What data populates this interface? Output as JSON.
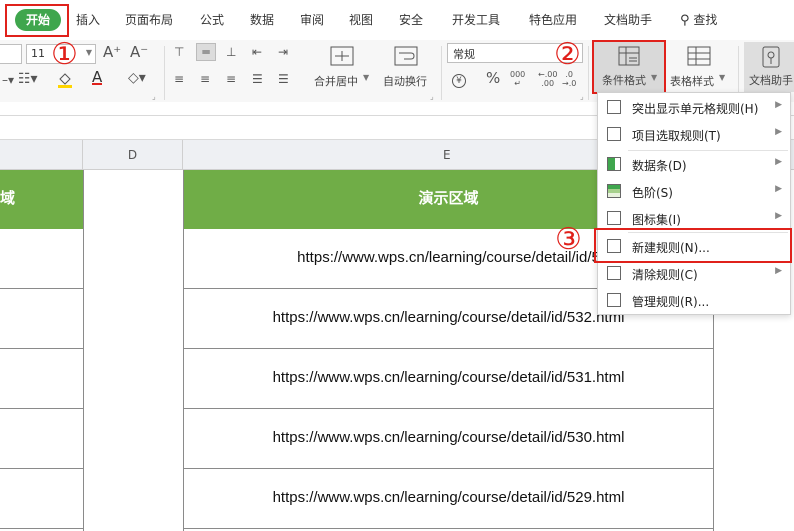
{
  "tabs": {
    "home": "开始",
    "items": [
      "插入",
      "页面布局",
      "公式",
      "数据",
      "审阅",
      "视图",
      "安全",
      "开发工具",
      "特色应用",
      "文档助手"
    ],
    "search": "查找"
  },
  "ribbon": {
    "font_size": "11",
    "font_grow": "A⁺",
    "font_shrink": "A⁻",
    "merge_label": "合并居中",
    "wrap_label": "自动换行",
    "number_format": "常规",
    "currency": "¥",
    "percent": "%",
    "thousands": "000",
    "dec_inc": ".00",
    "dec_dec": ".0",
    "cond_format_label": "条件格式",
    "table_style_label": "表格样式",
    "doc_helper_label": "文档助手"
  },
  "annotations": [
    "①",
    "②",
    "③"
  ],
  "sheet": {
    "col_d": "D",
    "col_e": "E",
    "header_left": "域",
    "header_e": "演示区域",
    "rows": [
      "https://www.wps.cn/learning/course/detail/id/5",
      "https://www.wps.cn/learning/course/detail/id/532.html",
      "https://www.wps.cn/learning/course/detail/id/531.html",
      "https://www.wps.cn/learning/course/detail/id/530.html",
      "https://www.wps.cn/learning/course/detail/id/529.html"
    ]
  },
  "menu": {
    "items": [
      {
        "label": "突出显示单元格规则(H)",
        "icon": "highlight-cells-icon",
        "submenu": true
      },
      {
        "label": "项目选取规则(T)",
        "icon": "top-bottom-icon",
        "submenu": true
      },
      {
        "label": "数据条(D)",
        "icon": "data-bars-icon",
        "submenu": true
      },
      {
        "label": "色阶(S)",
        "icon": "color-scales-icon",
        "submenu": true
      },
      {
        "label": "图标集(I)",
        "icon": "icon-sets-icon",
        "submenu": true
      },
      {
        "label": "新建规则(N)...",
        "icon": "new-rule-icon",
        "submenu": false
      },
      {
        "label": "清除规则(C)",
        "icon": "clear-rules-icon",
        "submenu": true
      },
      {
        "label": "管理规则(R)...",
        "icon": "manage-rules-icon",
        "submenu": false
      }
    ]
  },
  "colors": {
    "accent_red": "#e0211b",
    "home_green": "#3fa64d",
    "header_green": "#70ad47"
  }
}
